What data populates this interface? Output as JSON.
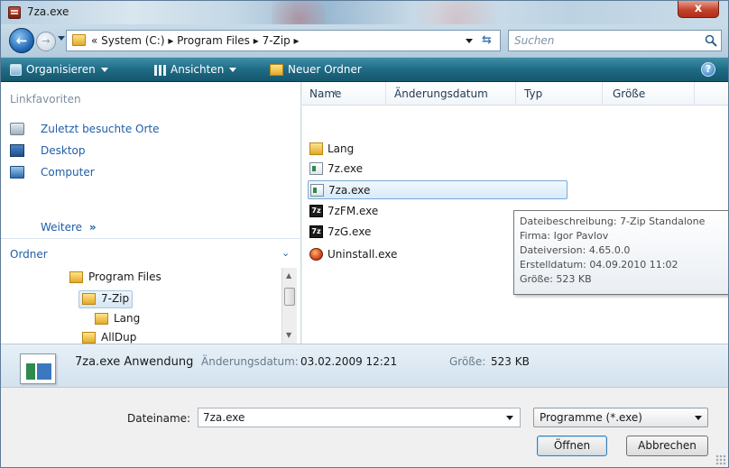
{
  "window": {
    "title": "7za.exe",
    "close_label": "x"
  },
  "address": {
    "path": "« System (C:) ▸ Program Files ▸ 7-Zip ▸",
    "search_placeholder": "Suchen"
  },
  "toolbar": {
    "organize_label": "Organisieren",
    "views_label": "Ansichten",
    "new_folder_label": "Neuer Ordner",
    "help_label": "?"
  },
  "navigation": {
    "favorites_header": "Linkfavoriten",
    "favorites": [
      {
        "label": "Zuletzt besuchte Orte",
        "icon": "recent-places-icon"
      },
      {
        "label": "Desktop",
        "icon": "desktop-icon"
      },
      {
        "label": "Computer",
        "icon": "computer-icon"
      }
    ],
    "more_label": "Weitere",
    "more_chevron": "»",
    "folders_header": "Ordner",
    "folders_caret": "⌄",
    "tree": [
      {
        "label": "Program Files",
        "depth": 0
      },
      {
        "label": "7-Zip",
        "depth": 1,
        "selected": true
      },
      {
        "label": "Lang",
        "depth": 2
      },
      {
        "label": "AllDup",
        "depth": 1
      }
    ]
  },
  "file_list": {
    "columns": [
      "Name",
      "Änderungsdatum",
      "Typ",
      "Größe"
    ],
    "files": [
      {
        "name": "Lang",
        "icon": "folder-icon"
      },
      {
        "name": "7z.exe",
        "icon": "exe-icon"
      },
      {
        "name": "7za.exe",
        "icon": "exe-icon",
        "selected": true
      },
      {
        "name": "7zFM.exe",
        "icon": "7z-icon"
      },
      {
        "name": "7zG.exe",
        "icon": "7z-icon"
      },
      {
        "name": "Uninstall.exe",
        "icon": "uninstall-icon"
      }
    ]
  },
  "tooltip": {
    "lines": [
      "Dateibeschreibung: 7-Zip Standalone",
      "Firma: Igor Pavlov",
      "Dateiversion: 4.65.0.0",
      "Erstelldatum: 04.09.2010 11:02",
      "Größe: 523 KB"
    ]
  },
  "details": {
    "name": "7za.exe Anwendung",
    "modified_label": "Änderungsdatum:",
    "modified_value": "03.02.2009 12:21",
    "size_label": "Größe:",
    "size_value": "523 KB"
  },
  "footer": {
    "filename_label": "Dateiname:",
    "filename_value": "7za.exe",
    "filetype_value": "Programme (*.exe)",
    "open_label": "Öffnen",
    "cancel_label": "Abbrechen"
  },
  "colors": {
    "accent": "#1f6b85",
    "link": "#1f5ea8",
    "close": "#c4422c"
  }
}
